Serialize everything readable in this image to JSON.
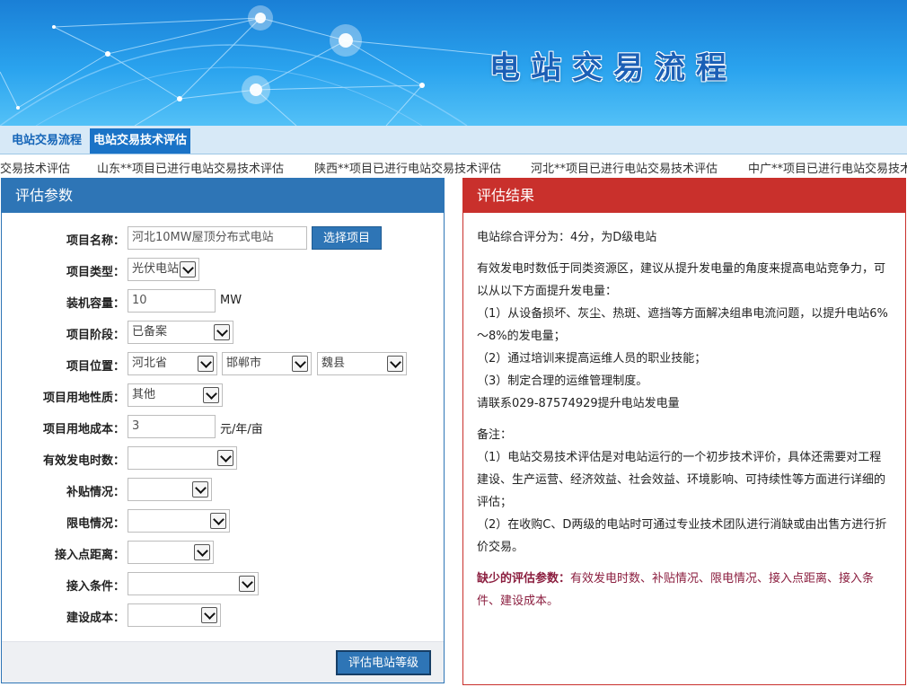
{
  "banner": {
    "title": "电站交易流程"
  },
  "tabs": [
    {
      "label": "电站交易流程"
    },
    {
      "label": "电站交易技术评估"
    }
  ],
  "ticker": [
    "交易技术评估",
    "山东**项目已进行电站交易技术评估",
    "陕西**项目已进行电站交易技术评估",
    "河北**项目已进行电站交易技术评估",
    "中广**项目已进行电站交易技术"
  ],
  "left_panel": {
    "title": "评估参数",
    "fields": {
      "name": {
        "label": "项目名称：",
        "value": "河北10MW屋顶分布式电站",
        "button": "选择项目"
      },
      "type": {
        "label": "项目类型：",
        "value": "光伏电站"
      },
      "capacity": {
        "label": "装机容量：",
        "value": "10",
        "unit": "MW"
      },
      "stage": {
        "label": "项目阶段：",
        "value": "已备案"
      },
      "location": {
        "label": "项目位置：",
        "province": "河北省",
        "city": "邯郸市",
        "county": "魏县"
      },
      "land_nature": {
        "label": "项目用地性质：",
        "value": "其他"
      },
      "land_cost": {
        "label": "项目用地成本：",
        "value": "3",
        "unit": "元/年/亩"
      },
      "hours": {
        "label": "有效发电时数：",
        "value": ""
      },
      "subsidy": {
        "label": "补贴情况：",
        "value": ""
      },
      "curtail": {
        "label": "限电情况：",
        "value": ""
      },
      "distance": {
        "label": "接入点距离：",
        "value": ""
      },
      "condition": {
        "label": "接入条件：",
        "value": ""
      },
      "build_cost": {
        "label": "建设成本：",
        "value": ""
      }
    },
    "eval_button": "评估电站等级"
  },
  "right_panel": {
    "title": "评估结果",
    "score": "电站综合评分为：4分，为D级电站",
    "advice_lines": [
      "有效发电时数低于同类资源区，建议从提升发电量的角度来提高电站竞争力，可以从以下方面提升发电量：",
      "（1）从设备损坏、灰尘、热斑、遮挡等方面解决组串电流问题，以提升电站6%～8%的发电量；",
      "（2）通过培训来提高运维人员的职业技能；",
      "（3）制定合理的运维管理制度。",
      "请联系029-87574929提升电站发电量"
    ],
    "notes_title": "备注：",
    "notes": [
      "（1）电站交易技术评估是对电站运行的一个初步技术评价，具体还需要对工程建设、生产运营、经济效益、社会效益、环境影响、可持续性等方面进行详细的评估；",
      "（2）在收购C、D两级的电站时可通过专业技术团队进行消缺或由出售方进行折价交易。"
    ],
    "missing_title": "缺少的评估参数：",
    "missing_body": "有效发电时数、补贴情况、限电情况、接入点距离、接入条件、建设成本。"
  }
}
